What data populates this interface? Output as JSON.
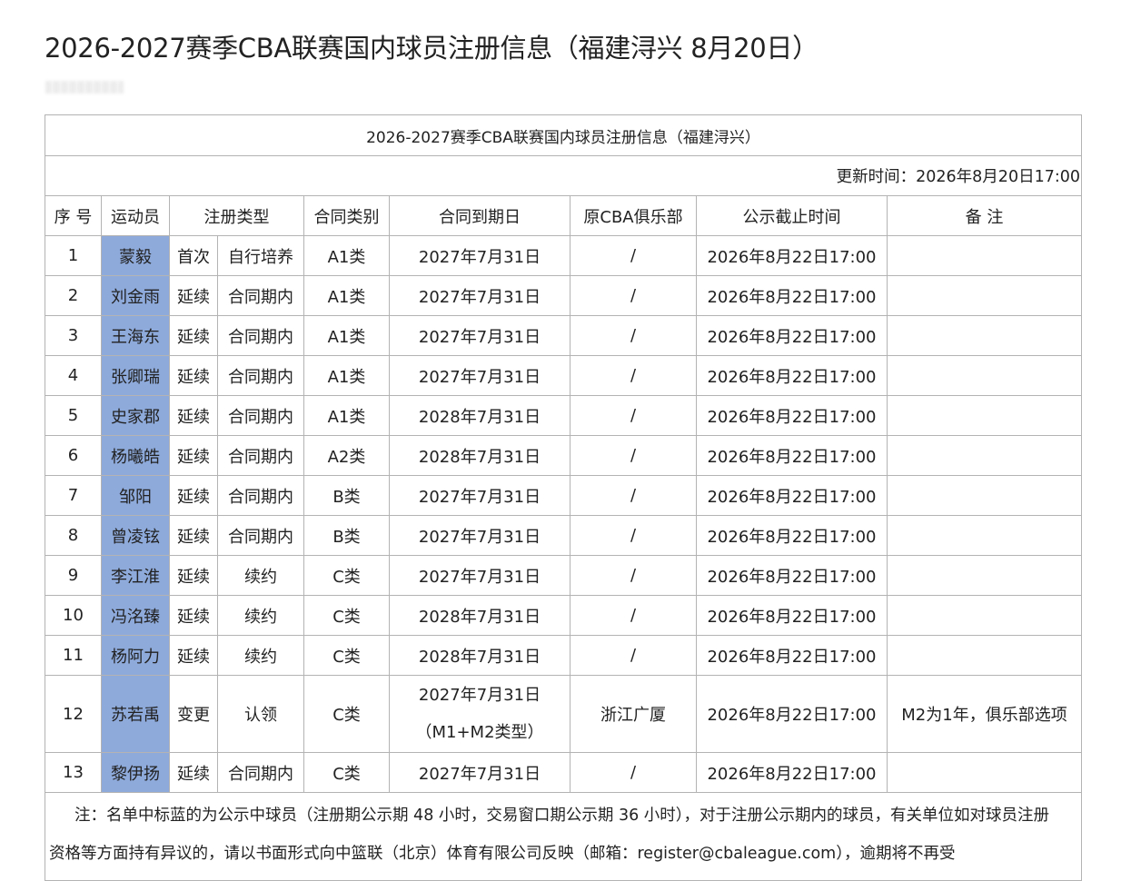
{
  "page": {
    "title": "2026-2027赛季CBA联赛国内球员注册信息（福建浔兴 8月20日）"
  },
  "table": {
    "caption": "2026-2027赛季CBA联赛国内球员注册信息（福建浔兴）",
    "updated": "更新时间：2026年8月20日17:00",
    "headers": [
      "序 号",
      "运动员",
      "注册类型",
      "合同类别",
      "合同到期日",
      "原CBA俱乐部",
      "公示截止时间",
      "备 注"
    ],
    "rows": [
      {
        "no": "1",
        "player": "蒙毅",
        "reg1": "首次",
        "reg2": "自行培养",
        "cat": "A1类",
        "expiry": "2027年7月31日",
        "expiry2": "",
        "club": "/",
        "deadline": "2026年8月22日17:00",
        "note": ""
      },
      {
        "no": "2",
        "player": "刘金雨",
        "reg1": "延续",
        "reg2": "合同期内",
        "cat": "A1类",
        "expiry": "2027年7月31日",
        "expiry2": "",
        "club": "/",
        "deadline": "2026年8月22日17:00",
        "note": ""
      },
      {
        "no": "3",
        "player": "王海东",
        "reg1": "延续",
        "reg2": "合同期内",
        "cat": "A1类",
        "expiry": "2027年7月31日",
        "expiry2": "",
        "club": "/",
        "deadline": "2026年8月22日17:00",
        "note": ""
      },
      {
        "no": "4",
        "player": "张卿瑞",
        "reg1": "延续",
        "reg2": "合同期内",
        "cat": "A1类",
        "expiry": "2027年7月31日",
        "expiry2": "",
        "club": "/",
        "deadline": "2026年8月22日17:00",
        "note": ""
      },
      {
        "no": "5",
        "player": "史家郡",
        "reg1": "延续",
        "reg2": "合同期内",
        "cat": "A1类",
        "expiry": "2028年7月31日",
        "expiry2": "",
        "club": "/",
        "deadline": "2026年8月22日17:00",
        "note": ""
      },
      {
        "no": "6",
        "player": "杨曦皓",
        "reg1": "延续",
        "reg2": "合同期内",
        "cat": "A2类",
        "expiry": "2028年7月31日",
        "expiry2": "",
        "club": "/",
        "deadline": "2026年8月22日17:00",
        "note": ""
      },
      {
        "no": "7",
        "player": "邹阳",
        "reg1": "延续",
        "reg2": "合同期内",
        "cat": "B类",
        "expiry": "2027年7月31日",
        "expiry2": "",
        "club": "/",
        "deadline": "2026年8月22日17:00",
        "note": ""
      },
      {
        "no": "8",
        "player": "曾凌铉",
        "reg1": "延续",
        "reg2": "合同期内",
        "cat": "B类",
        "expiry": "2027年7月31日",
        "expiry2": "",
        "club": "/",
        "deadline": "2026年8月22日17:00",
        "note": ""
      },
      {
        "no": "9",
        "player": "李江淮",
        "reg1": "延续",
        "reg2": "续约",
        "cat": "C类",
        "expiry": "2027年7月31日",
        "expiry2": "",
        "club": "/",
        "deadline": "2026年8月22日17:00",
        "note": ""
      },
      {
        "no": "10",
        "player": "冯洺臻",
        "reg1": "延续",
        "reg2": "续约",
        "cat": "C类",
        "expiry": "2028年7月31日",
        "expiry2": "",
        "club": "/",
        "deadline": "2026年8月22日17:00",
        "note": ""
      },
      {
        "no": "11",
        "player": "杨阿力",
        "reg1": "延续",
        "reg2": "续约",
        "cat": "C类",
        "expiry": "2028年7月31日",
        "expiry2": "",
        "club": "/",
        "deadline": "2026年8月22日17:00",
        "note": ""
      },
      {
        "no": "12",
        "player": "苏若禹",
        "reg1": "变更",
        "reg2": "认领",
        "cat": "C类",
        "expiry": "2027年7月31日",
        "expiry2": "（M1+M2类型）",
        "club": "浙江广厦",
        "deadline": "2026年8月22日17:00",
        "note": "M2为1年，俱乐部选项"
      },
      {
        "no": "13",
        "player": "黎伊扬",
        "reg1": "延续",
        "reg2": "合同期内",
        "cat": "C类",
        "expiry": "2027年7月31日",
        "expiry2": "",
        "club": "/",
        "deadline": "2026年8月22日17:00",
        "note": ""
      }
    ],
    "footnote": "注：名单中标蓝的为公示中球员（注册期公示期 48 小时，交易窗口期公示期 36 小时），对于注册公示期内的球员，有关单位如对球员注册资格等方面持有异议的，请以书面形式向中篮联（北京）体育有限公司反映（邮箱：register@cbaleague.com），逾期将不再受"
  },
  "colors": {
    "player_highlight": "#8eaadb",
    "border": "#b3b3b3"
  }
}
